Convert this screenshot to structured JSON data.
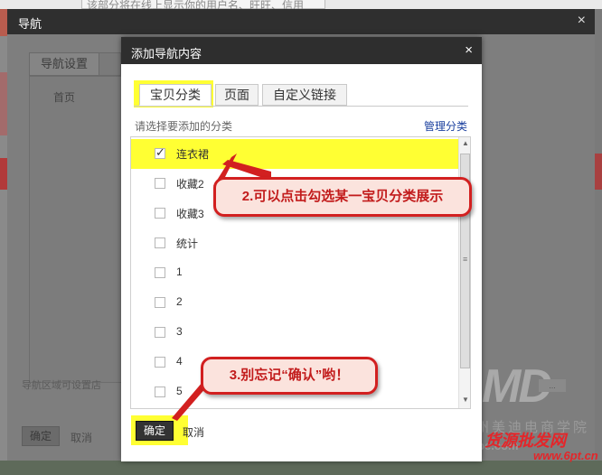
{
  "background": {
    "top_text": "该部分将在线上显示你的用户名、旺旺、信用"
  },
  "outer_dialog": {
    "title": "导航",
    "close": "×",
    "tab_label": "导航设置",
    "home_label": "首页",
    "hint": "导航区域可设置店",
    "ok_label": "确定",
    "cancel_label": "取消"
  },
  "dialog": {
    "title": "添加导航内容",
    "close": "×",
    "tabs": [
      {
        "label": "宝贝分类",
        "active": true
      },
      {
        "label": "页面",
        "active": false
      },
      {
        "label": "自定义链接",
        "active": false
      }
    ],
    "prompt": "请选择要添加的分类",
    "manage_link": "管理分类",
    "items": [
      {
        "label": "连衣裙",
        "checked": true
      },
      {
        "label": "收藏2",
        "checked": false
      },
      {
        "label": "收藏3",
        "checked": false
      },
      {
        "label": "统计",
        "checked": false
      },
      {
        "label": "1",
        "checked": false
      },
      {
        "label": "2",
        "checked": false
      },
      {
        "label": "3",
        "checked": false
      },
      {
        "label": "4",
        "checked": false
      },
      {
        "label": "5",
        "checked": false
      }
    ],
    "ok_label": "确定",
    "cancel_label": "取消"
  },
  "annotations": {
    "callout_1": "2.可以点击勾选某一宝贝分类展示",
    "callout_2": "3.别忘记“确认”哟！"
  },
  "watermark": {
    "logo": "MD",
    "logo_small": "...",
    "company": "广州美迪电商学院",
    "site": "Mebe.com",
    "red_text": "货源批发网",
    "red_url": "www.6pt.cn"
  },
  "colors": {
    "highlight": "#ffff33",
    "callout_border": "#d22020",
    "link": "#1a3f9e",
    "header": "#2e2e2e"
  }
}
